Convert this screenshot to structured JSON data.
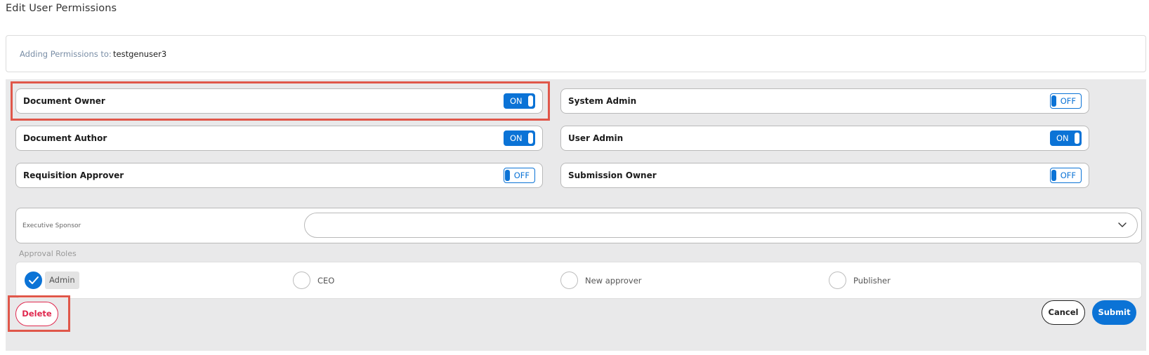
{
  "page": {
    "title": "Edit User Permissions"
  },
  "adding": {
    "label": "Adding Permissions to:",
    "user": "testgenuser3"
  },
  "permissions": [
    {
      "label": "Document Owner",
      "state": "ON"
    },
    {
      "label": "System Admin",
      "state": "OFF"
    },
    {
      "label": "Document Author",
      "state": "ON"
    },
    {
      "label": "User Admin",
      "state": "ON"
    },
    {
      "label": "Requisition Approver",
      "state": "OFF"
    },
    {
      "label": "Submission Owner",
      "state": "OFF"
    }
  ],
  "sponsor": {
    "label": "Executive Sponsor",
    "value": ""
  },
  "approval": {
    "title": "Approval Roles",
    "roles": [
      {
        "label": "Admin",
        "checked": true
      },
      {
        "label": "CEO",
        "checked": false
      },
      {
        "label": "New approver",
        "checked": false
      },
      {
        "label": "Publisher",
        "checked": false
      }
    ]
  },
  "buttons": {
    "delete": "Delete",
    "cancel": "Cancel",
    "submit": "Submit"
  },
  "colors": {
    "accent": "#0b73d6",
    "danger": "#e0294f",
    "highlight": "#e0574a",
    "panel": "#e9e9ea"
  },
  "icons": {
    "dropdown": "chevron-down-icon",
    "check": "check-icon"
  }
}
